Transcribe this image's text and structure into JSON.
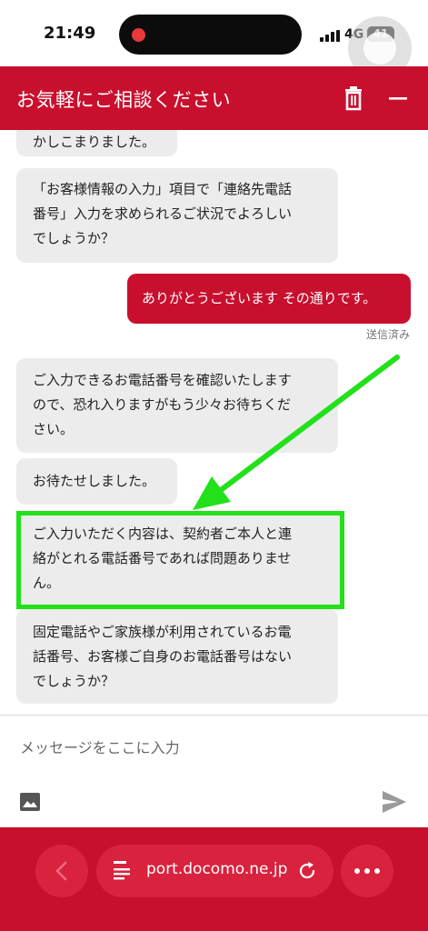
{
  "status_bar": {
    "time": "21:49",
    "network": "4G",
    "battery": "41"
  },
  "header": {
    "title": "お気軽にご相談ください",
    "trash_icon": "trash-icon",
    "minimize_icon": "minus-icon"
  },
  "chat": {
    "messages": [
      {
        "from": "agent",
        "lines": [
          "かしこまりました。"
        ]
      },
      {
        "from": "agent",
        "lines": [
          "「お客様情報の入力」項目で「連絡先電話",
          "番号」入力を求められるご状況でよろしい",
          "でしょうか？"
        ]
      },
      {
        "from": "user",
        "lines": [
          "ありがとうございます その通りです。"
        ],
        "status": "送信済み"
      },
      {
        "from": "agent",
        "lines": [
          "ご入力できるお電話番号を確認いたします",
          "ので、恐れ入りますがもう少々お待ちくだ",
          "さい。"
        ]
      },
      {
        "from": "agent",
        "lines": [
          "お待たせしました。"
        ]
      },
      {
        "from": "agent",
        "lines": [
          "ご入力いただく内容は、契約者ご本人と連",
          "絡がとれる電話番号であれば問題ありませ",
          "ん。"
        ],
        "highlighted": true
      },
      {
        "from": "agent",
        "lines": [
          "固定電話やご家族様が利用されているお電",
          "話番号、お客様ご自身のお電話番号はない",
          "でしょうか？"
        ]
      }
    ]
  },
  "input": {
    "placeholder": "メッセージをここに入力",
    "image_icon": "image-icon",
    "send_icon": "send-icon"
  },
  "browser_bar": {
    "url": "port.docomo.ne.jp",
    "back_icon": "chevron-left-icon",
    "reload_icon": "reload-icon",
    "more_icon": "more-icon"
  },
  "colors": {
    "brand": "#c8102e",
    "agent_bubble": "#ececec",
    "highlight": "#22e01a"
  }
}
